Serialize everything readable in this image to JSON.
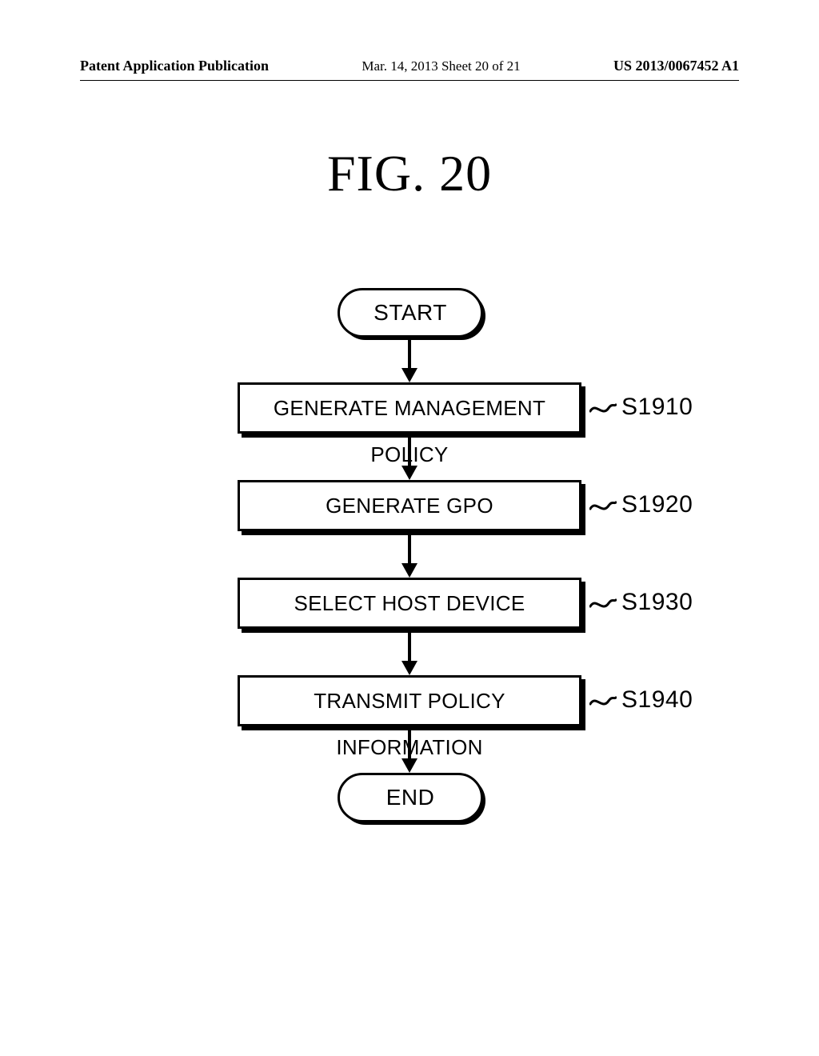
{
  "header": {
    "publication": "Patent Application Publication",
    "date_sheet": "Mar. 14, 2013  Sheet 20 of 21",
    "docnum": "US 2013/0067452 A1"
  },
  "figure": {
    "title": "FIG.  20"
  },
  "flow": {
    "start": "START",
    "end": "END",
    "steps": [
      {
        "label": "GENERATE MANAGEMENT POLICY",
        "ref": "S1910"
      },
      {
        "label": "GENERATE GPO",
        "ref": "S1920"
      },
      {
        "label": "SELECT HOST DEVICE",
        "ref": "S1930"
      },
      {
        "label": "TRANSMIT POLICY INFORMATION",
        "ref": "S1940"
      }
    ]
  },
  "chart_data": {
    "type": "flowchart",
    "title": "FIG. 20",
    "nodes": [
      {
        "id": "start",
        "shape": "terminator",
        "label": "START"
      },
      {
        "id": "s1910",
        "shape": "process",
        "label": "GENERATE MANAGEMENT POLICY",
        "ref": "S1910"
      },
      {
        "id": "s1920",
        "shape": "process",
        "label": "GENERATE GPO",
        "ref": "S1920"
      },
      {
        "id": "s1930",
        "shape": "process",
        "label": "SELECT HOST DEVICE",
        "ref": "S1930"
      },
      {
        "id": "s1940",
        "shape": "process",
        "label": "TRANSMIT POLICY INFORMATION",
        "ref": "S1940"
      },
      {
        "id": "end",
        "shape": "terminator",
        "label": "END"
      }
    ],
    "edges": [
      [
        "start",
        "s1910"
      ],
      [
        "s1910",
        "s1920"
      ],
      [
        "s1920",
        "s1930"
      ],
      [
        "s1930",
        "s1940"
      ],
      [
        "s1940",
        "end"
      ]
    ]
  }
}
